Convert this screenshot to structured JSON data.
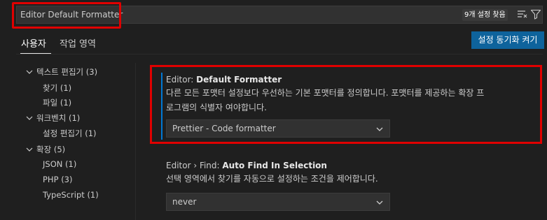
{
  "search": {
    "value": "Editor Default Formatter",
    "result_count": "9개 설정 찾음"
  },
  "tabs": {
    "user": "사용자",
    "workspace": "작업 영역"
  },
  "sync_button": "설정 동기화 켜기",
  "tree": [
    {
      "label": "텍스트 편집기",
      "count": "(3)",
      "expanded": true
    },
    {
      "label": "찾기",
      "count": "(1)"
    },
    {
      "label": "파일",
      "count": "(1)"
    },
    {
      "label": "워크벤치",
      "count": "(1)",
      "expanded": true
    },
    {
      "label": "설정 편집기",
      "count": "(1)"
    },
    {
      "label": "확장",
      "count": "(5)",
      "expanded": true
    },
    {
      "label": "JSON",
      "count": "(1)"
    },
    {
      "label": "PHP",
      "count": "(3)"
    },
    {
      "label": "TypeScript",
      "count": "(1)"
    }
  ],
  "settings": [
    {
      "category": "Editor: ",
      "name": "Default Formatter",
      "description_line1": "다른 모든 포맷터 설정보다 우선하는 기본 포맷터를 정의합니다. 포맷터를 제공하는 확장 프",
      "description_line2": "로그램의 식별자 여야합니다.",
      "value": "Prettier - Code formatter"
    },
    {
      "category": "Editor › Find: ",
      "name": "Auto Find In Selection",
      "description_line1": "선택 영역에서 찾기를 자동으로 설정하는 조건을 제어합니다.",
      "value": "never"
    }
  ],
  "colors": {
    "accent": "#0078d4",
    "button": "#0e639c",
    "highlight": "#e00000"
  }
}
